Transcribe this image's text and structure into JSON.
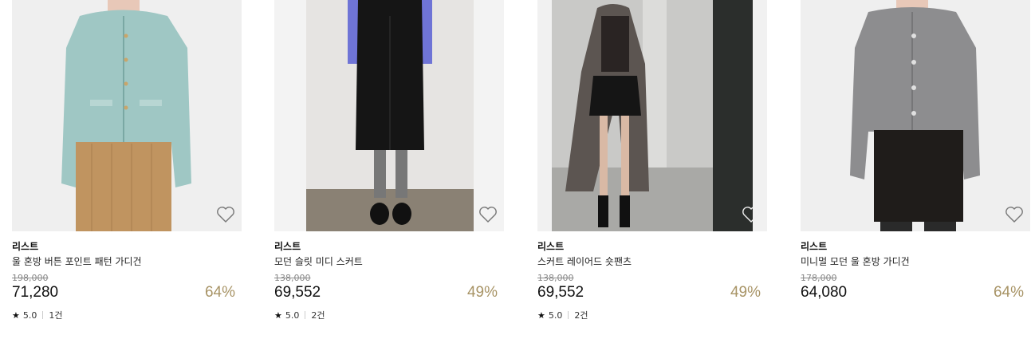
{
  "products": [
    {
      "brand": "리스트",
      "name": "울 혼방 버튼 포인트 패턴 가디건",
      "original_price": "198,000",
      "price": "71,280",
      "discount": "64%",
      "rating": "5.0",
      "reviews": "1건",
      "has_rating": true
    },
    {
      "brand": "리스트",
      "name": "모던 슬릿 미디 스커트",
      "original_price": "138,000",
      "price": "69,552",
      "discount": "49%",
      "rating": "5.0",
      "reviews": "2건",
      "has_rating": true
    },
    {
      "brand": "리스트",
      "name": "스커트 레이어드 숏팬츠",
      "original_price": "138,000",
      "price": "69,552",
      "discount": "49%",
      "rating": "5.0",
      "reviews": "2건",
      "has_rating": true
    },
    {
      "brand": "리스트",
      "name": "미니멀 모던 울 혼방 가디건",
      "original_price": "178,000",
      "price": "64,080",
      "discount": "64%",
      "has_rating": false
    }
  ],
  "icons": {
    "wishlist": "heart-outline-icon",
    "rating": "star-icon"
  },
  "colors": {
    "discount": "#a89466",
    "text": "#111111",
    "muted": "#888888"
  }
}
